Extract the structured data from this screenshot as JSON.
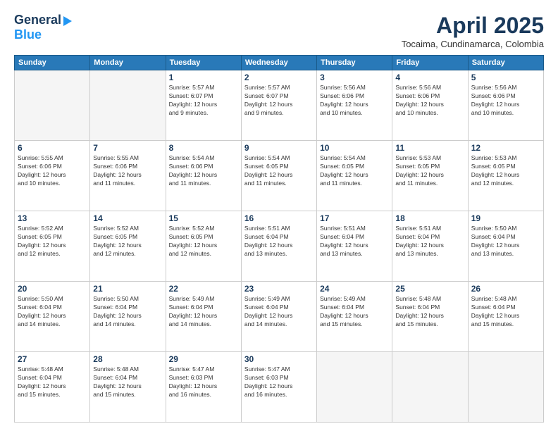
{
  "header": {
    "logo_general": "General",
    "logo_blue": "Blue",
    "month": "April 2025",
    "location": "Tocaima, Cundinamarca, Colombia"
  },
  "columns": [
    "Sunday",
    "Monday",
    "Tuesday",
    "Wednesday",
    "Thursday",
    "Friday",
    "Saturday"
  ],
  "weeks": [
    [
      {
        "day": "",
        "info": ""
      },
      {
        "day": "",
        "info": ""
      },
      {
        "day": "1",
        "info": "Sunrise: 5:57 AM\nSunset: 6:07 PM\nDaylight: 12 hours\nand 9 minutes."
      },
      {
        "day": "2",
        "info": "Sunrise: 5:57 AM\nSunset: 6:07 PM\nDaylight: 12 hours\nand 9 minutes."
      },
      {
        "day": "3",
        "info": "Sunrise: 5:56 AM\nSunset: 6:06 PM\nDaylight: 12 hours\nand 10 minutes."
      },
      {
        "day": "4",
        "info": "Sunrise: 5:56 AM\nSunset: 6:06 PM\nDaylight: 12 hours\nand 10 minutes."
      },
      {
        "day": "5",
        "info": "Sunrise: 5:56 AM\nSunset: 6:06 PM\nDaylight: 12 hours\nand 10 minutes."
      }
    ],
    [
      {
        "day": "6",
        "info": "Sunrise: 5:55 AM\nSunset: 6:06 PM\nDaylight: 12 hours\nand 10 minutes."
      },
      {
        "day": "7",
        "info": "Sunrise: 5:55 AM\nSunset: 6:06 PM\nDaylight: 12 hours\nand 11 minutes."
      },
      {
        "day": "8",
        "info": "Sunrise: 5:54 AM\nSunset: 6:06 PM\nDaylight: 12 hours\nand 11 minutes."
      },
      {
        "day": "9",
        "info": "Sunrise: 5:54 AM\nSunset: 6:05 PM\nDaylight: 12 hours\nand 11 minutes."
      },
      {
        "day": "10",
        "info": "Sunrise: 5:54 AM\nSunset: 6:05 PM\nDaylight: 12 hours\nand 11 minutes."
      },
      {
        "day": "11",
        "info": "Sunrise: 5:53 AM\nSunset: 6:05 PM\nDaylight: 12 hours\nand 11 minutes."
      },
      {
        "day": "12",
        "info": "Sunrise: 5:53 AM\nSunset: 6:05 PM\nDaylight: 12 hours\nand 12 minutes."
      }
    ],
    [
      {
        "day": "13",
        "info": "Sunrise: 5:52 AM\nSunset: 6:05 PM\nDaylight: 12 hours\nand 12 minutes."
      },
      {
        "day": "14",
        "info": "Sunrise: 5:52 AM\nSunset: 6:05 PM\nDaylight: 12 hours\nand 12 minutes."
      },
      {
        "day": "15",
        "info": "Sunrise: 5:52 AM\nSunset: 6:05 PM\nDaylight: 12 hours\nand 12 minutes."
      },
      {
        "day": "16",
        "info": "Sunrise: 5:51 AM\nSunset: 6:04 PM\nDaylight: 12 hours\nand 13 minutes."
      },
      {
        "day": "17",
        "info": "Sunrise: 5:51 AM\nSunset: 6:04 PM\nDaylight: 12 hours\nand 13 minutes."
      },
      {
        "day": "18",
        "info": "Sunrise: 5:51 AM\nSunset: 6:04 PM\nDaylight: 12 hours\nand 13 minutes."
      },
      {
        "day": "19",
        "info": "Sunrise: 5:50 AM\nSunset: 6:04 PM\nDaylight: 12 hours\nand 13 minutes."
      }
    ],
    [
      {
        "day": "20",
        "info": "Sunrise: 5:50 AM\nSunset: 6:04 PM\nDaylight: 12 hours\nand 14 minutes."
      },
      {
        "day": "21",
        "info": "Sunrise: 5:50 AM\nSunset: 6:04 PM\nDaylight: 12 hours\nand 14 minutes."
      },
      {
        "day": "22",
        "info": "Sunrise: 5:49 AM\nSunset: 6:04 PM\nDaylight: 12 hours\nand 14 minutes."
      },
      {
        "day": "23",
        "info": "Sunrise: 5:49 AM\nSunset: 6:04 PM\nDaylight: 12 hours\nand 14 minutes."
      },
      {
        "day": "24",
        "info": "Sunrise: 5:49 AM\nSunset: 6:04 PM\nDaylight: 12 hours\nand 15 minutes."
      },
      {
        "day": "25",
        "info": "Sunrise: 5:48 AM\nSunset: 6:04 PM\nDaylight: 12 hours\nand 15 minutes."
      },
      {
        "day": "26",
        "info": "Sunrise: 5:48 AM\nSunset: 6:04 PM\nDaylight: 12 hours\nand 15 minutes."
      }
    ],
    [
      {
        "day": "27",
        "info": "Sunrise: 5:48 AM\nSunset: 6:04 PM\nDaylight: 12 hours\nand 15 minutes."
      },
      {
        "day": "28",
        "info": "Sunrise: 5:48 AM\nSunset: 6:04 PM\nDaylight: 12 hours\nand 15 minutes."
      },
      {
        "day": "29",
        "info": "Sunrise: 5:47 AM\nSunset: 6:03 PM\nDaylight: 12 hours\nand 16 minutes."
      },
      {
        "day": "30",
        "info": "Sunrise: 5:47 AM\nSunset: 6:03 PM\nDaylight: 12 hours\nand 16 minutes."
      },
      {
        "day": "",
        "info": ""
      },
      {
        "day": "",
        "info": ""
      },
      {
        "day": "",
        "info": ""
      }
    ]
  ]
}
